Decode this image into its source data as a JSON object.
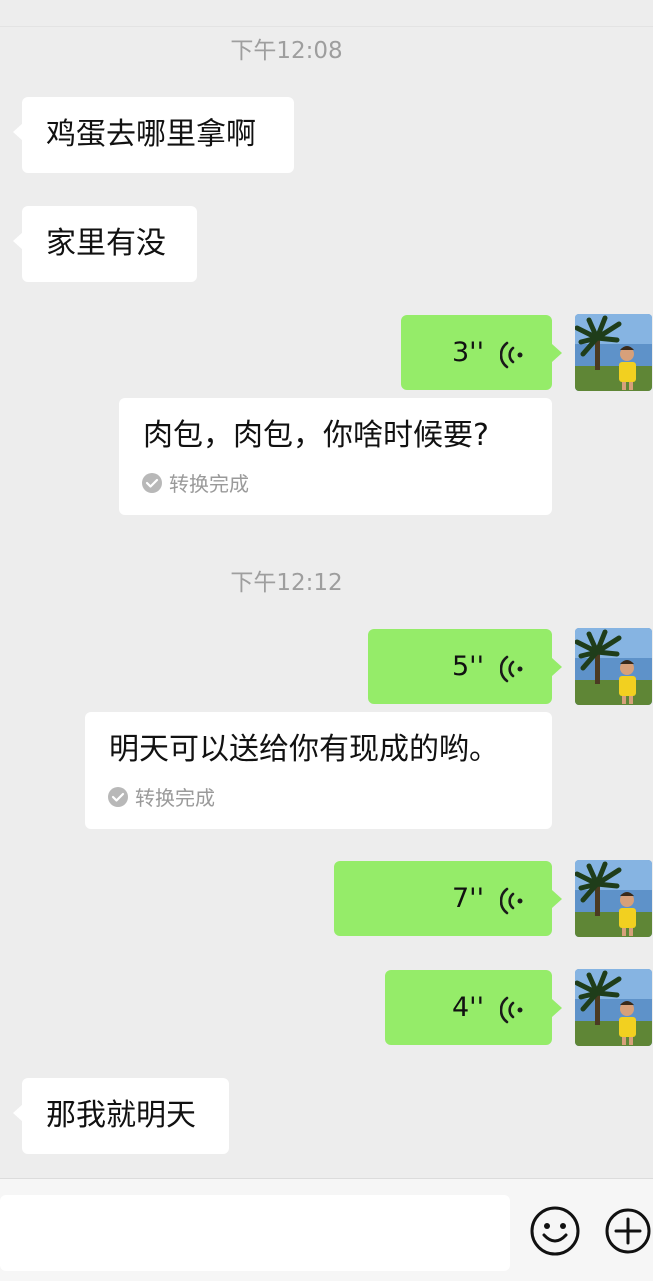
{
  "chat": {
    "timestamp_1": "下午12:08",
    "timestamp_2": "下午12:12",
    "msg_in_1": "鸡蛋去哪里拿啊",
    "msg_in_2": "家里有没",
    "voice_1": {
      "duration": "3''",
      "transcript": "肉包，肉包，你啥时候要?",
      "status": "转换完成"
    },
    "voice_2": {
      "duration": "5''",
      "transcript": "明天可以送给你有现成的哟。",
      "status": "转换完成"
    },
    "voice_3": {
      "duration": "7''"
    },
    "voice_4": {
      "duration": "4''"
    },
    "msg_in_3": "那我就明天"
  },
  "input": {
    "emoji_icon": "smiley-face-icon",
    "plus_icon": "plus-circle-icon"
  },
  "colors": {
    "background": "#ededed",
    "outgoing_bubble": "#95ec69",
    "incoming_bubble": "#ffffff",
    "timestamp": "#9e9e9e"
  }
}
